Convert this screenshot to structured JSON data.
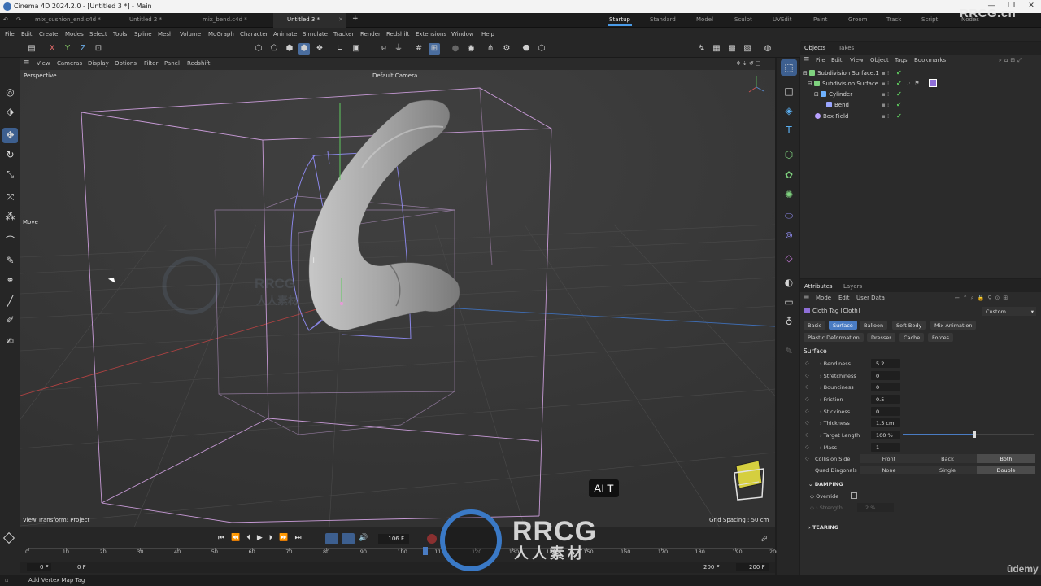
{
  "window": {
    "title": "Cinema 4D 2024.2.0 - [Untitled 3 *] - Main",
    "minimize": "—",
    "maximize": "❐",
    "close": "✕"
  },
  "watermark": {
    "corner": "RRCG.cn",
    "center_main": "RRCG",
    "center_sub": "人人素材",
    "bg_main": "RRCG",
    "bg_sub": "人人素材",
    "udemy": "ûdemy"
  },
  "tabs": [
    {
      "label": "mix_cushion_end.c4d *"
    },
    {
      "label": "Untitled 2 *"
    },
    {
      "label": "mix_bend.c4d *"
    },
    {
      "label": "Untitled 3 *"
    }
  ],
  "new_tab": "+",
  "layouts": [
    "Startup",
    "Standard",
    "Model",
    "Sculpt",
    "UVEdit",
    "Paint",
    "Groom",
    "Track",
    "Script",
    "Nodes"
  ],
  "menu": [
    "File",
    "Edit",
    "Create",
    "Modes",
    "Select",
    "Tools",
    "Spline",
    "Mesh",
    "Volume",
    "MoGraph",
    "Character",
    "Animate",
    "Simulate",
    "Tracker",
    "Render",
    "Redshift",
    "Extensions",
    "Window",
    "Help"
  ],
  "toolbar": {
    "x": "X",
    "y": "Y",
    "z": "Z"
  },
  "viewport_menu": [
    "View",
    "Cameras",
    "Display",
    "Options",
    "Filter",
    "Panel",
    "Redshift"
  ],
  "viewport": {
    "name": "Perspective",
    "camera": "Default Camera",
    "tool": "Move",
    "view_transform": "View Transform: Project",
    "grid_spacing": "Grid Spacing : 50 cm",
    "key_hint": "ALT",
    "axis_y": "Y",
    "axis_x": "X",
    "axis_z": "Z"
  },
  "timeline": {
    "current_frame": "106 F",
    "ticks": [
      "0",
      "10",
      "20",
      "30",
      "40",
      "50",
      "60",
      "70",
      "80",
      "90",
      "100",
      "110",
      "120",
      "130",
      "140",
      "150",
      "160",
      "170",
      "180",
      "190",
      "200"
    ],
    "start": "0 F",
    "start2": "0 F",
    "end": "200 F",
    "end2": "200 F",
    "playhead_fraction": 0.53
  },
  "objects_panel": {
    "tabs": [
      "Objects",
      "Takes"
    ],
    "menu": [
      "File",
      "Edit",
      "View",
      "Object",
      "Tags",
      "Bookmarks"
    ],
    "items": [
      {
        "label": "Subdivision Surface.1",
        "color": "#7fd27f"
      },
      {
        "label": "Subdivision Surface",
        "color": "#7fd27f"
      },
      {
        "label": "Cylinder",
        "color": "#6fb2ff"
      },
      {
        "label": "Bend",
        "color": "#9aa6ff"
      },
      {
        "label": "Box Field",
        "color": "#b8a0ff"
      }
    ]
  },
  "attributes_panel": {
    "tabs": [
      "Attributes",
      "Layers"
    ],
    "menu": [
      "Mode",
      "Edit",
      "User Data"
    ],
    "object": "Cloth Tag [Cloth]",
    "preset": "Custom",
    "buttons_row1": [
      "Basic",
      "Surface",
      "Balloon",
      "Soft Body",
      "Mix Animation"
    ],
    "buttons_row2": [
      "Plastic Deformation",
      "Dresser",
      "Cache",
      "Forces"
    ],
    "section": "Surface",
    "params": [
      {
        "label": "Bendiness",
        "value": "5.2"
      },
      {
        "label": "Stretchiness",
        "value": "0"
      },
      {
        "label": "Bounciness",
        "value": "0"
      },
      {
        "label": "Friction",
        "value": "0.5"
      },
      {
        "label": "Stickiness",
        "value": "0"
      },
      {
        "label": "Thickness",
        "value": "1.5 cm"
      },
      {
        "label": "Target Length",
        "value": "100 %"
      },
      {
        "label": "Mass",
        "value": "1"
      }
    ],
    "target_length_slider": 0.54,
    "collision_side": {
      "label": "Collision Side",
      "options": [
        "Front",
        "Back",
        "Both"
      ],
      "selected": "Both"
    },
    "quad_diagonals": {
      "label": "Quad Diagonals",
      "options": [
        "None",
        "Single",
        "Double"
      ],
      "selected": "Double"
    },
    "damping": {
      "title": "DAMPING",
      "override": "Override",
      "strength_label": "Strength",
      "strength_value": "2 %"
    },
    "tearing": {
      "title": "TEARING"
    }
  },
  "status": {
    "text": "Add Vertex Map Tag"
  },
  "colors": {
    "accent": "#4a7cc3",
    "viewport_bg": "#3a3a3a",
    "panel_bg": "#2b2b2b",
    "cage": "#c79ad6",
    "deformer": "#8a86e6"
  }
}
